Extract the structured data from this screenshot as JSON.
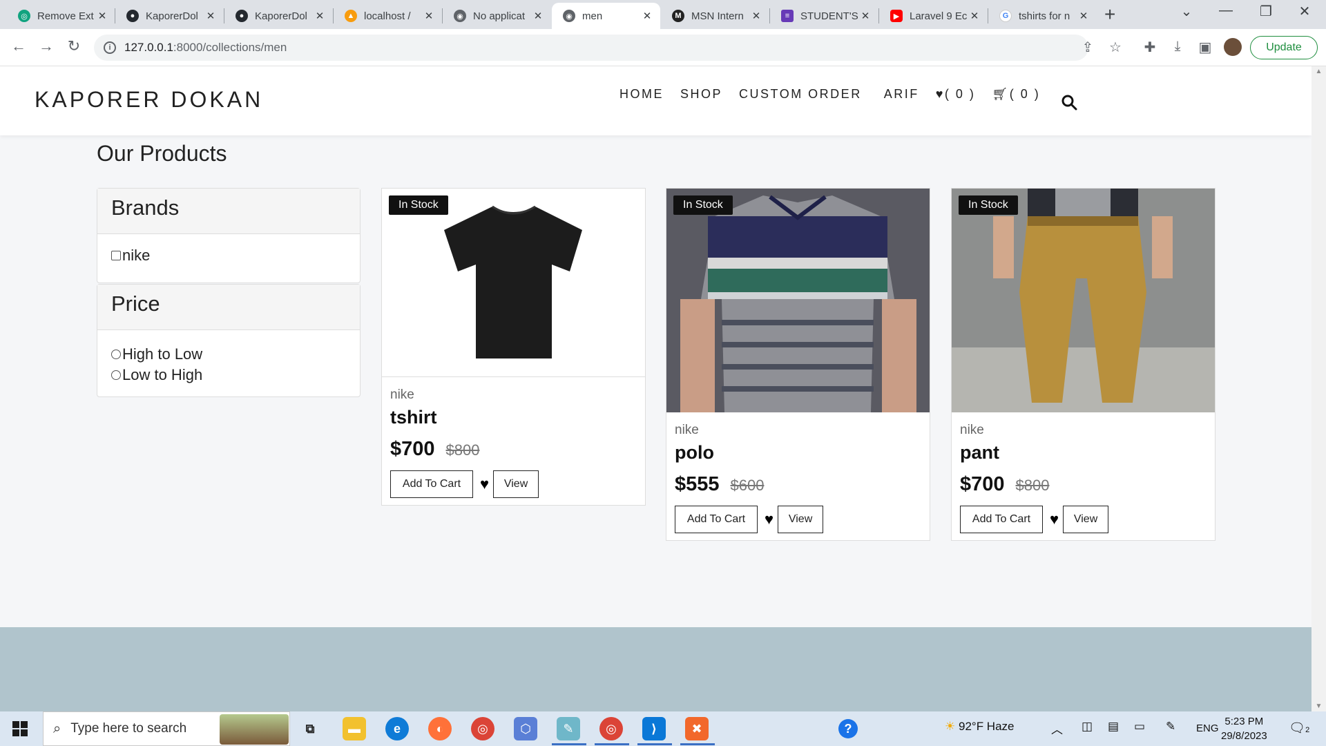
{
  "browser": {
    "tabs": [
      {
        "title": "Remove Ext",
        "icon": "openai-icon",
        "color": "#10a37f"
      },
      {
        "title": "KaporerDol",
        "icon": "github-icon",
        "color": "#24292f"
      },
      {
        "title": "KaporerDol",
        "icon": "github-icon",
        "color": "#24292f"
      },
      {
        "title": "localhost /",
        "icon": "phpmyadmin-icon",
        "color": "#f89c0e"
      },
      {
        "title": "No applicat",
        "icon": "globe-icon",
        "color": "#5f6368"
      },
      {
        "title": "men",
        "icon": "globe-icon",
        "color": "#5f6368"
      },
      {
        "title": "MSN Intern",
        "icon": "msn-icon",
        "color": "#222222"
      },
      {
        "title": "STUDENT'S",
        "icon": "forms-icon",
        "color": "#673ab7"
      },
      {
        "title": "Laravel 9 Ec",
        "icon": "youtube-icon",
        "color": "#ff0000"
      },
      {
        "title": "tshirts for n",
        "icon": "google-icon",
        "color": "#4285f4"
      }
    ],
    "active_tab_index": 5,
    "url_host": "127.0.0.1",
    "url_rest": ":8000/collections/men",
    "update_label": "Update"
  },
  "site": {
    "logo": "KAPORER DOKAN",
    "nav": {
      "home": "HOME",
      "shop": "SHOP",
      "custom_order": "CUSTOM ORDER",
      "user": "ARIF",
      "wishlist_count": "( 0 )",
      "cart_count": "( 0 )"
    },
    "products_title": "Our Products",
    "filters": {
      "brands_title": "Brands",
      "brands": [
        "nike"
      ],
      "price_title": "Price",
      "price_options": [
        "High to Low",
        "Low to High"
      ]
    },
    "products": [
      {
        "badge": "In Stock",
        "brand": "nike",
        "name": "tshirt",
        "price": "$700",
        "old_price": "$800",
        "add_label": "Add To Cart",
        "view_label": "View"
      },
      {
        "badge": "In Stock",
        "brand": "nike",
        "name": "polo",
        "price": "$555",
        "old_price": "$600",
        "add_label": "Add To Cart",
        "view_label": "View"
      },
      {
        "badge": "In Stock",
        "brand": "nike",
        "name": "pant",
        "price": "$700",
        "old_price": "$800",
        "add_label": "Add To Cart",
        "view_label": "View"
      }
    ]
  },
  "taskbar": {
    "search_placeholder": "Type here to search",
    "weather": "92°F  Haze",
    "lang": "ENG",
    "time": "5:23 PM",
    "date": "29/8/2023",
    "notification_count": "2"
  }
}
